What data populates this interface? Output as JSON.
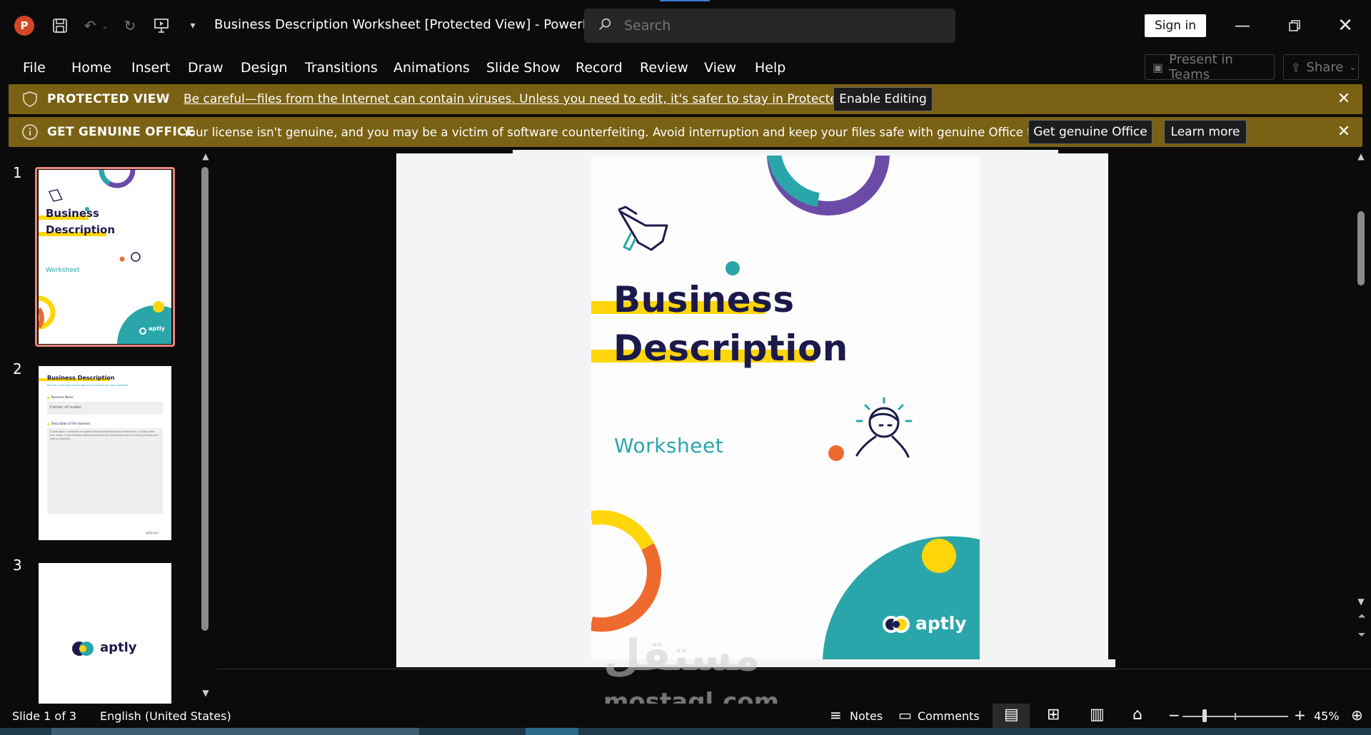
{
  "app": {
    "doc_title": "Business Description Worksheet [Protected View]  -  PowerP...",
    "search_placeholder": "Search",
    "sign_in": "Sign in"
  },
  "menu": {
    "items": [
      "File",
      "Home",
      "Insert",
      "Draw",
      "Design",
      "Transitions",
      "Animations",
      "Slide Show",
      "Record",
      "Review",
      "View",
      "Help"
    ],
    "present_in_teams": "Present in Teams",
    "share": "Share"
  },
  "protected_view": {
    "title": "PROTECTED VIEW",
    "message": "Be careful—files from the Internet can contain viruses. Unless you need to edit, it's safer to stay in Protected View.",
    "enable_editing": "Enable Editing"
  },
  "genuine_office": {
    "title": "GET GENUINE OFFICE",
    "message": "Your license isn't genuine, and you may be a victim of software counterfeiting. Avoid interruption and keep your files safe with genuine Office today.",
    "get_genuine": "Get genuine Office",
    "learn_more": "Learn more"
  },
  "thumbnails": {
    "numbers": [
      "1",
      "2",
      "3"
    ],
    "slide1": {
      "title_line1": "Business",
      "title_line2": "Description",
      "subtitle": "Worksheet",
      "brand": "aptly"
    },
    "slide2": {
      "title": "Business Description",
      "subtitle": "Provide a brief description about the business you have selected",
      "field1_label": "Business Name",
      "field1_value": "Center of sudan",
      "field2_label": "Description of the business",
      "field2_value": "A retail store: a collection of system and products belonging to Sudanese in a country other than Sudan. It also includes mobile accessories and maintenance work including purchase and selling computers.",
      "footer": "aptly.xxx"
    },
    "slide3": {
      "brand": "aptly"
    }
  },
  "slide": {
    "title_line1": "Business",
    "title_line2": "Description",
    "subtitle": "Worksheet",
    "brand": "aptly"
  },
  "watermark": {
    "arabic": "مستقل",
    "latin": "mostaql.com"
  },
  "status": {
    "slide_indicator": "Slide 1 of 3",
    "language": "English (United States)",
    "notes": "Notes",
    "comments": "Comments",
    "zoom": "45%"
  },
  "colors": {
    "navy": "#1b1a4a",
    "teal": "#2aa6aa",
    "yellow": "#ffd60a",
    "orange": "#ee6a2e",
    "purple": "#6b4aa8",
    "msgbar": "#7a6114"
  }
}
